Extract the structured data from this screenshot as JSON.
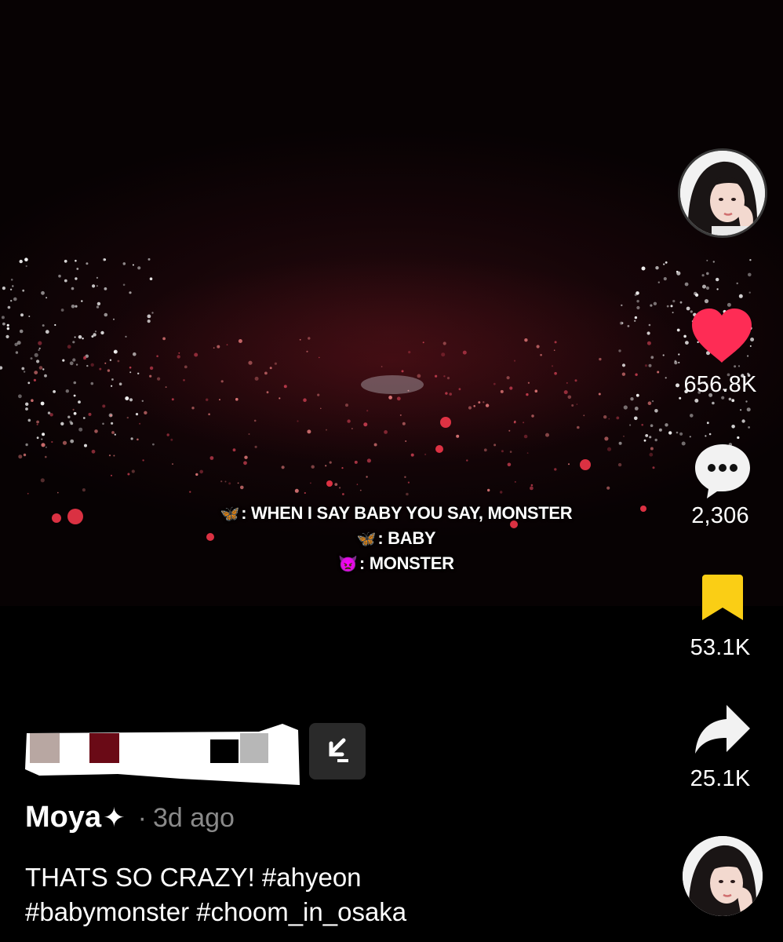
{
  "video": {
    "caption_lines": [
      {
        "icon": "butterfly-icon",
        "text": ": WHEN I SAY BABY YOU SAY, MONSTER"
      },
      {
        "icon": "butterfly-icon",
        "text": ": BABY"
      },
      {
        "icon": "devil-icon",
        "text": ": MONSTER"
      }
    ]
  },
  "actions": {
    "likes": "656.8K",
    "comments": "2,306",
    "saves": "53.1K",
    "shares": "25.1K",
    "like_color": "#fe2c55",
    "save_color": "#face15"
  },
  "post": {
    "author": "Moya",
    "author_suffix": "✦",
    "separator": "·",
    "time": "3d ago",
    "caption_text": "THATS SO CRAZY!",
    "hashtags": [
      "#ahyeon",
      "#babymonster",
      "#choom_in_osaka"
    ]
  }
}
